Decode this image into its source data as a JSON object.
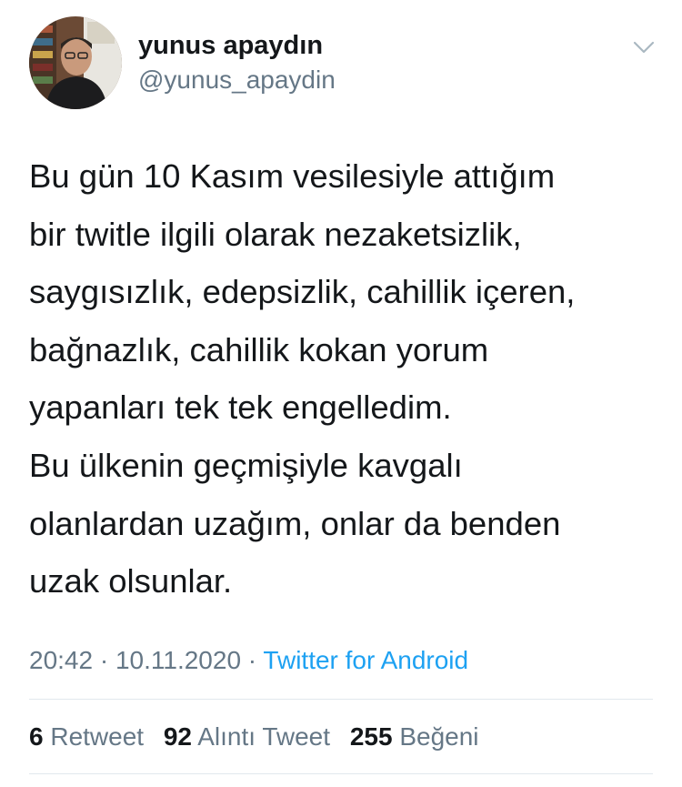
{
  "user": {
    "display_name": "yunus apaydın",
    "handle": "@yunus_apaydin"
  },
  "tweet": {
    "text": "Bu gün 10 Kasım vesilesiyle attığım\nbir twitle ilgili olarak nezaketsizlik,\nsaygısızlık, edepsizlik, cahillik içeren,\nbağnazlık, cahillik kokan yorum\nyapanları tek tek engelledim.\nBu ülkenin geçmişiyle kavgalı\nolanlardan uzağım, onlar da benden\nuzak olsunlar."
  },
  "meta": {
    "time": "20:42",
    "sep1": " · ",
    "date": "10.11.2020",
    "sep2": " · ",
    "source": "Twitter for Android"
  },
  "stats": [
    {
      "count": "6",
      "label": "Retweet"
    },
    {
      "count": "92",
      "label": "Alıntı Tweet"
    },
    {
      "count": "255",
      "label": "Beğeni"
    }
  ],
  "icons": {
    "more_menu": "chevron-down-icon"
  },
  "colors": {
    "text": "#14171a",
    "secondary": "#657786",
    "link": "#1da1f2",
    "divider": "#e1e8ed"
  }
}
